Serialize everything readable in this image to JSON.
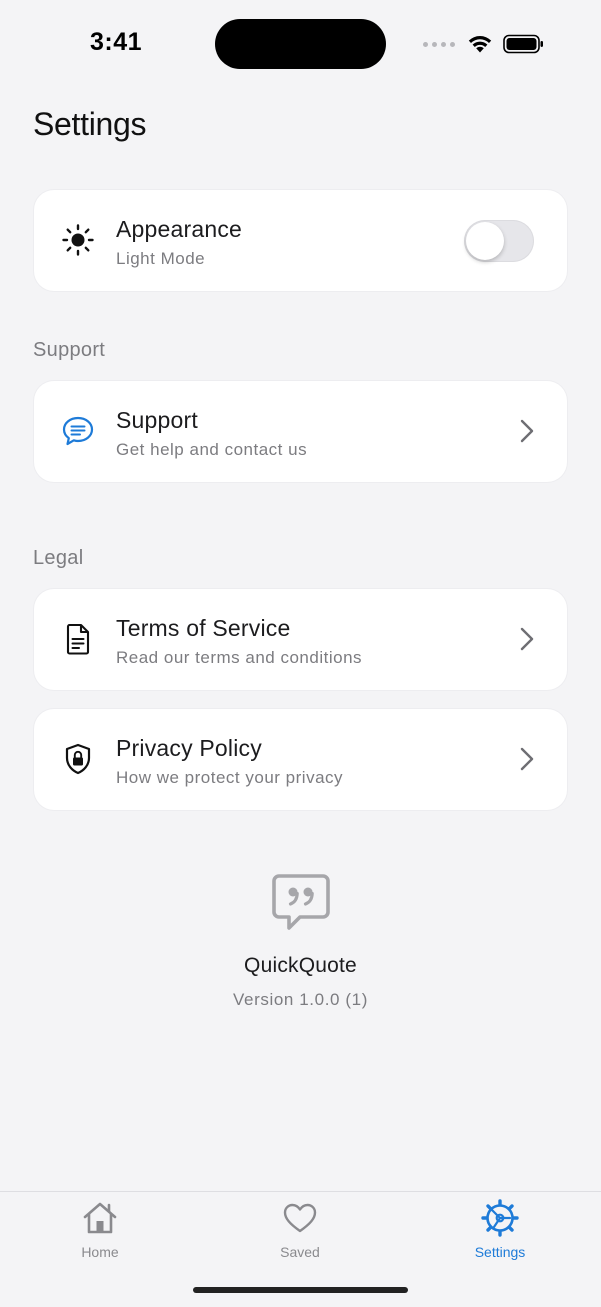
{
  "status_bar": {
    "time": "3:41"
  },
  "page": {
    "title": "Settings"
  },
  "appearance": {
    "title": "Appearance",
    "subtitle": "Light Mode",
    "icon": "sun-icon",
    "toggle_on": false
  },
  "sections": {
    "support_label": "Support",
    "legal_label": "Legal"
  },
  "support_item": {
    "title": "Support",
    "subtitle": "Get help and contact us",
    "icon": "chat-bubble-icon"
  },
  "terms_item": {
    "title": "Terms of Service",
    "subtitle": "Read our terms and conditions",
    "icon": "document-icon"
  },
  "privacy_item": {
    "title": "Privacy Policy",
    "subtitle": "How we protect your privacy",
    "icon": "shield-lock-icon"
  },
  "about": {
    "app_name": "QuickQuote",
    "version": "Version 1.0.0 (1)",
    "icon": "quote-bubble-icon"
  },
  "tab_bar": {
    "tabs": [
      {
        "label": "Home",
        "icon": "home-icon",
        "active": false
      },
      {
        "label": "Saved",
        "icon": "heart-icon",
        "active": false
      },
      {
        "label": "Settings",
        "icon": "settings-gear-icon",
        "active": true
      }
    ]
  },
  "colors": {
    "accent": "#1e7bd8",
    "background": "#f4f4f6",
    "card": "#ffffff",
    "secondary_text": "#7c7c80",
    "inactive_tab": "#8a8a8e"
  }
}
